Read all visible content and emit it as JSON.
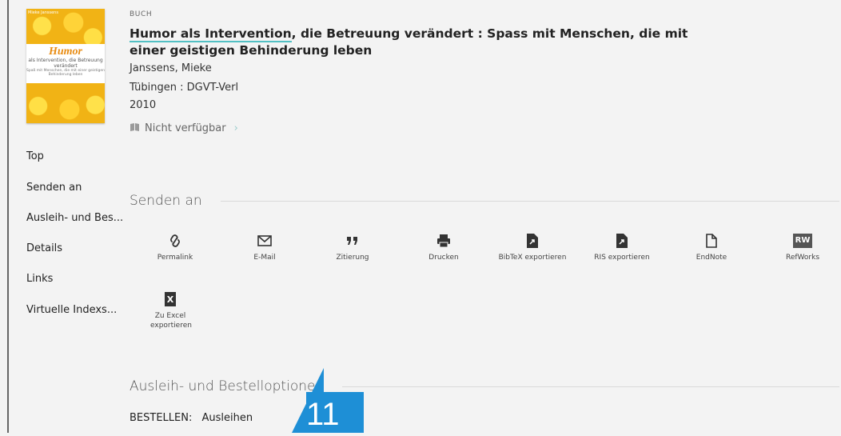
{
  "record": {
    "type_label": "BUCH",
    "title_linked": "Humor als Intervention",
    "title_rest": ", die Betreuung verändert : Spass mit Menschen, die mit einer geistigen Behinderung leben",
    "author": "Janssens, Mieke",
    "publisher": "Tübingen : DGVT-Verl",
    "year": "2010",
    "availability": "Nicht verfügbar"
  },
  "cover": {
    "title": "Humor",
    "subtitle": "als Intervention, die Betreuung verändert",
    "small": "Spaß mit Menschen, die mit einer geistigen Behinderung leben",
    "author_small": "Mieke Janssens"
  },
  "nav": {
    "items": [
      {
        "label": "Top"
      },
      {
        "label": "Senden an"
      },
      {
        "label": "Ausleih- und Bes..."
      },
      {
        "label": "Details"
      },
      {
        "label": "Links"
      },
      {
        "label": "Virtuelle Indexs..."
      }
    ]
  },
  "send": {
    "title": "Senden an",
    "actions": [
      {
        "label": "Permalink",
        "icon": "link-icon"
      },
      {
        "label": "E-Mail",
        "icon": "mail-icon"
      },
      {
        "label": "Zitierung",
        "icon": "quote-icon"
      },
      {
        "label": "Drucken",
        "icon": "printer-icon"
      },
      {
        "label": "BibTeX exportieren",
        "icon": "file-export-icon"
      },
      {
        "label": "RIS exportieren",
        "icon": "file-export-icon"
      },
      {
        "label": "EndNote",
        "icon": "document-icon"
      },
      {
        "label": "RefWorks",
        "icon": "refworks-icon"
      },
      {
        "label": "Zu Excel exportieren",
        "icon": "excel-icon"
      }
    ],
    "refworks_badge": "RW",
    "excel_badge": "X"
  },
  "loan": {
    "title": "Ausleih- und Bestelloptionen",
    "order_label": "BESTELLEN:",
    "order_link": "Ausleihen"
  },
  "marker": {
    "number": "11",
    "color": "#1e8fd6"
  },
  "colors": {
    "background": "#f3f3f3",
    "title_underline": "#53c0c4"
  }
}
